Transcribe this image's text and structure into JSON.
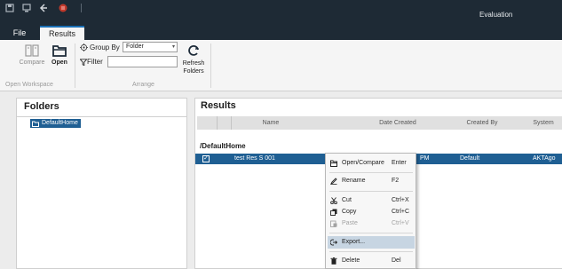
{
  "window": {
    "title": "Evaluation"
  },
  "quick_access": [
    "disk-icon",
    "monitor-icon",
    "back-arrow-icon",
    "stop-icon"
  ],
  "menu_tabs": [
    {
      "label": "File"
    },
    {
      "label": "Results",
      "active": true
    }
  ],
  "ribbon": {
    "compare_label": "Compare",
    "open_label": "Open",
    "open_workspace_group": "Open Workspace",
    "group_by_label": "Group By",
    "group_by_value": "Folder",
    "filter_label": "Filter",
    "filter_value": "",
    "refresh_label_1": "Refresh",
    "refresh_label_2": "Folders",
    "arrange_group": "Arrange"
  },
  "folders": {
    "title": "Folders",
    "items": [
      {
        "label": "DefaultHome",
        "selected": true
      }
    ]
  },
  "results": {
    "title": "Results",
    "columns": [
      "Name",
      "Date Created",
      "Created By",
      "System"
    ],
    "group": "/DefaultHome",
    "rows": [
      {
        "name": "test Res S 001",
        "date_created": "PM",
        "created_by": "Default",
        "system": "AKTAgo",
        "checked": true
      }
    ]
  },
  "context_menu": {
    "items": [
      {
        "label": "Open/Compare",
        "shortcut": "Enter",
        "icon": "folder-open-icon"
      },
      {
        "label": "Rename",
        "shortcut": "F2",
        "icon": "rename-icon"
      },
      {
        "label": "Cut",
        "shortcut": "Ctrl+X",
        "icon": "scissors-icon"
      },
      {
        "label": "Copy",
        "shortcut": "Ctrl+C",
        "icon": "copy-icon"
      },
      {
        "label": "Paste",
        "shortcut": "Ctrl+V",
        "icon": "paste-icon",
        "disabled": true
      },
      {
        "label": "Export...",
        "shortcut": "",
        "icon": "export-icon",
        "highlighted": true
      },
      {
        "label": "Delete",
        "shortcut": "Del",
        "icon": "trash-icon"
      }
    ]
  },
  "colors": {
    "title_bar": "#1e2a35",
    "accent_tab": "#1a6fb5",
    "selection": "#1f5f93",
    "menu_highlight": "#c7d5e2"
  }
}
